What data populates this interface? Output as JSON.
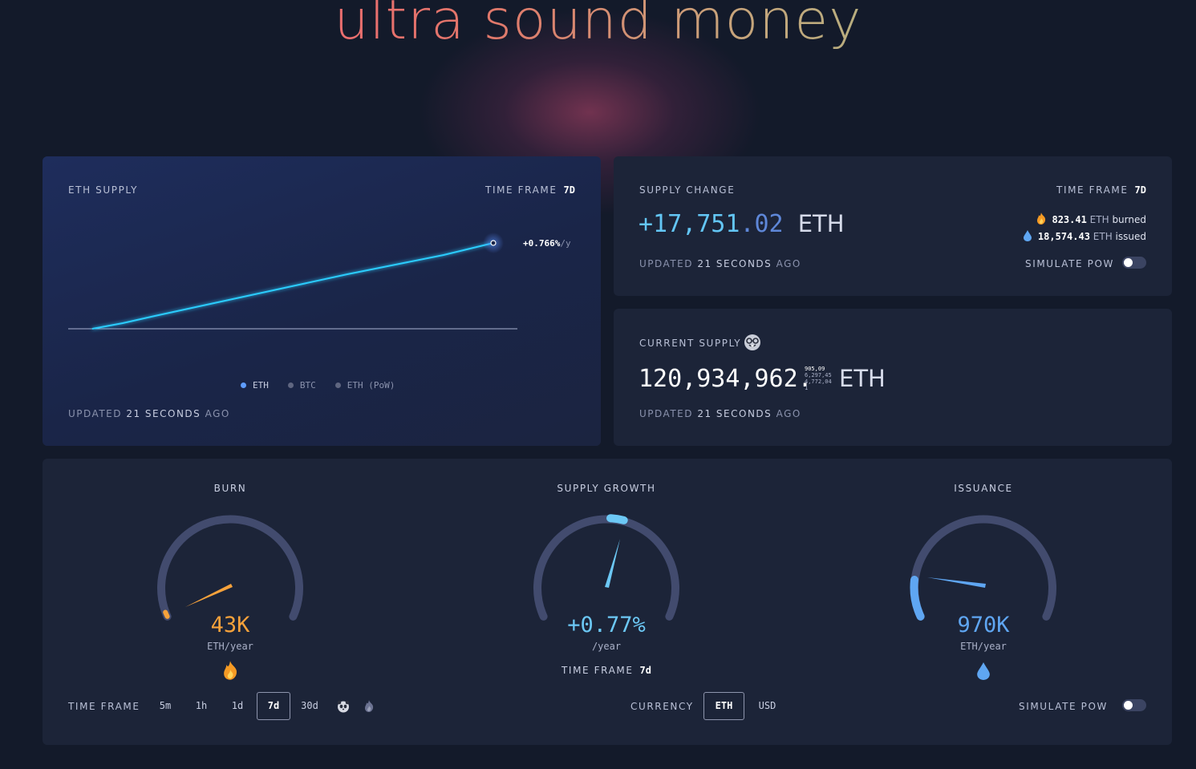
{
  "site": {
    "title": "ultra sound money"
  },
  "eth_supply": {
    "label": "ETH SUPPLY",
    "timeframe_label": "TIME FRAME",
    "timeframe_value": "7d",
    "rate_value": "+0.766%",
    "rate_unit": "/y",
    "legend": [
      {
        "label": "ETH",
        "active": true
      },
      {
        "label": "BTC",
        "active": false
      },
      {
        "label": "ETH (PoW)",
        "active": false
      }
    ],
    "updated_prefix": "UPDATED",
    "updated_num": "21",
    "updated_unit": "SECONDS",
    "updated_suffix": "AGO",
    "line_color": "#29c8ff"
  },
  "supply_change": {
    "label": "SUPPLY CHANGE",
    "timeframe_label": "TIME FRAME",
    "timeframe_value": "7d",
    "value_sign_num": "+17,751",
    "value_decimals": ".02",
    "unit": "ETH",
    "burned_value": "823.41",
    "burned_suffix": "ETH",
    "burned_word": "burned",
    "issued_value": "18,574.43",
    "issued_suffix": "ETH",
    "issued_word": "issued",
    "updated_prefix": "UPDATED",
    "updated_num": "21",
    "updated_unit": "SECONDS",
    "updated_suffix": "AGO",
    "simulate_label": "SIMULATE PoW",
    "simulate_on": false
  },
  "current_supply": {
    "label": "CURRENT SUPPLY",
    "emoji_icon": "nerd-face-icon",
    "value_int": "120,934,962.",
    "decimal_rows": [
      "905,09",
      "6,297,45",
      "4,772,04",
      "1"
    ],
    "unit": "ETH",
    "updated_prefix": "UPDATED",
    "updated_num": "21",
    "updated_unit": "SECONDS",
    "updated_suffix": "AGO"
  },
  "gauges": {
    "burn": {
      "title": "BURN",
      "value": "43K",
      "unit": "ETH/year",
      "icon": "fire-icon",
      "color": "#f7a23b",
      "level": 0.15
    },
    "growth": {
      "title": "SUPPLY GROWTH",
      "value": "+0.77%",
      "unit": "/year",
      "timeframe_label": "TIME FRAME",
      "timeframe_value": "7d",
      "color": "#6cc8f5",
      "level": 0.53
    },
    "issuance": {
      "title": "ISSUANCE",
      "value": "970K",
      "unit": "ETH/year",
      "icon": "droplet-icon",
      "color": "#5fa6f2",
      "level": 0.1
    }
  },
  "controls": {
    "timeframe_label": "TIME FRAME",
    "timeframes": [
      "5m",
      "1h",
      "1d",
      "7d",
      "30d"
    ],
    "selected_timeframe": "7d",
    "currency_label": "CURRENCY",
    "currencies": [
      "ETH",
      "USD"
    ],
    "selected_currency": "ETH",
    "simulate_label": "SIMULATE PoW",
    "simulate_on": false
  }
}
